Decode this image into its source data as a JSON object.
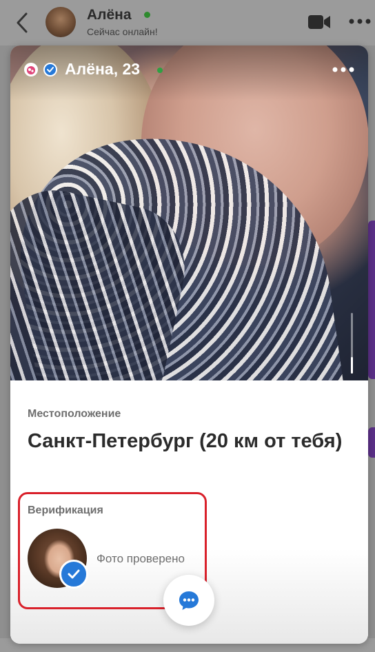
{
  "chat_header": {
    "name": "Алёна",
    "status": "Сейчас онлайн!",
    "icons": {
      "back": "chevron-left-icon",
      "video": "video-camera-icon",
      "more": "more-horizontal-icon"
    }
  },
  "profile_card": {
    "name_age": "Алёна, 23",
    "icons": {
      "badge": "flame-badge-icon",
      "verified": "verified-check-icon",
      "more": "more-horizontal-icon"
    },
    "colors": {
      "verified_blue": "#2679d8",
      "online_green": "#2ea043",
      "highlight_red": "#d9202a"
    },
    "location": {
      "label": "Местоположение",
      "value": "Санкт-Петербург (20 км от тебя)"
    },
    "verification": {
      "label": "Верификация",
      "status": "Фото проверено"
    },
    "chat_button_icon": "chat-bubble-icon"
  }
}
